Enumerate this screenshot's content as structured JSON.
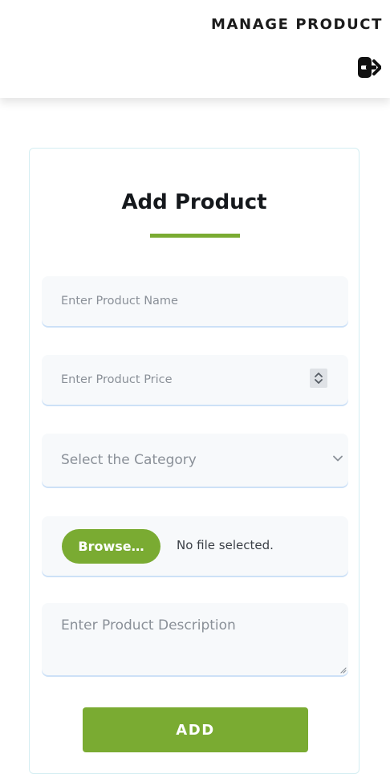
{
  "header": {
    "title": "MANAGE PRODUCT",
    "logout_icon": "logout-icon"
  },
  "form": {
    "title": "Add Product",
    "name_placeholder": "Enter Product Name",
    "price_placeholder": "Enter Product Price",
    "category_placeholder": "Select the Category",
    "browse_label": "Browse…",
    "file_status": "No file selected.",
    "description_placeholder": "Enter Product Description",
    "add_label": "ADD"
  },
  "icons": {
    "spinner": "number-stepper-icon",
    "select": "chevron-down-icon",
    "resize": "resize-grip-icon"
  },
  "colors": {
    "accent": "#7aab32",
    "field_bg": "#f7f9fb",
    "field_border": "#cde1f7",
    "card_border": "#d4eef2",
    "text_dark": "#1b1b1b",
    "placeholder": "#8a9098"
  }
}
